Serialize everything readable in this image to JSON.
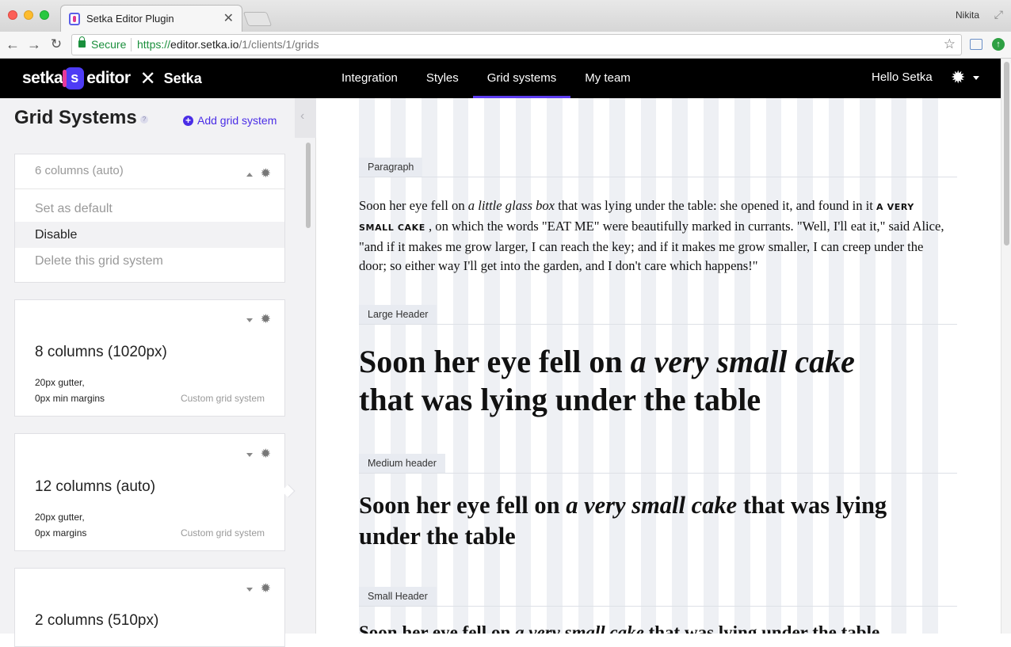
{
  "browser": {
    "tab_title": "Setka Editor Plugin",
    "tab_close": "✕",
    "profile": "Nikita",
    "secure_label": "Secure",
    "url_scheme": "https://",
    "url_host": "editor.setka.io",
    "url_path": "/1/clients/1/grids",
    "back_glyph": "←",
    "forward_glyph": "→",
    "reload_glyph": "↻",
    "star_glyph": "☆"
  },
  "header": {
    "brand_setka": "setka",
    "brand_s": "s",
    "brand_editor": "editor",
    "brand_x": "✕",
    "brand_client": "Setka",
    "nav": [
      {
        "label": "Integration",
        "active": false
      },
      {
        "label": "Styles",
        "active": false
      },
      {
        "label": "Grid systems",
        "active": true
      },
      {
        "label": "My team",
        "active": false
      }
    ],
    "greeting": "Hello Setka",
    "gear_glyph": "✹"
  },
  "sidebar": {
    "title": "Grid Systems",
    "help": "?",
    "add_label": "Add grid system",
    "collapse_glyph": "‹",
    "cards": [
      {
        "title": "6 columns (auto)",
        "expanded": true,
        "menu": [
          "Set as default",
          "Disable",
          "Delete this grid system"
        ],
        "hovered_menu_index": 1
      },
      {
        "title": "8 columns (1020px)",
        "meta_line1": "20px gutter,",
        "meta_line2": "0px min margins",
        "type": "Custom grid system"
      },
      {
        "title": "12 columns (auto)",
        "meta_line1": "20px gutter,",
        "meta_line2": "0px margins",
        "type": "Custom grid system",
        "selected": true
      },
      {
        "title": "2 columns (510px)"
      }
    ]
  },
  "preview": {
    "sections": [
      {
        "label": "Paragraph",
        "text_a": "Soon her eye fell on ",
        "text_b": "a little glass box",
        "text_c": " that was lying under the table: she opened it, and found in it ",
        "text_caps": "A VERY SMALL CAKE",
        "text_d": " , on which the words \"EAT ME\" were beautifully marked in currants. \"Well, I'll eat it,\" said Alice, \"and if it makes me grow larger, I can reach the key; and if it makes me grow smaller, I can creep under the door; so either way I'll get into the garden, and I don't care which happens!\""
      },
      {
        "label": "Large Header",
        "text_a": "Soon her eye fell on ",
        "text_b": "a very small cake",
        "text_c": " that was lying under the table"
      },
      {
        "label": "Medium header",
        "text_a": "Soon her eye fell on ",
        "text_b": "a very small cake",
        "text_c": " that was lying under the table"
      },
      {
        "label": "Small Header",
        "text_a": "Soon her eye fell on ",
        "text_b": "a very small cake",
        "text_c": " that was lying under the table"
      }
    ]
  },
  "colors": {
    "accent": "#4a2de6",
    "nav_underline": "#5c3cf0",
    "grid_column": "#eef0f4"
  }
}
